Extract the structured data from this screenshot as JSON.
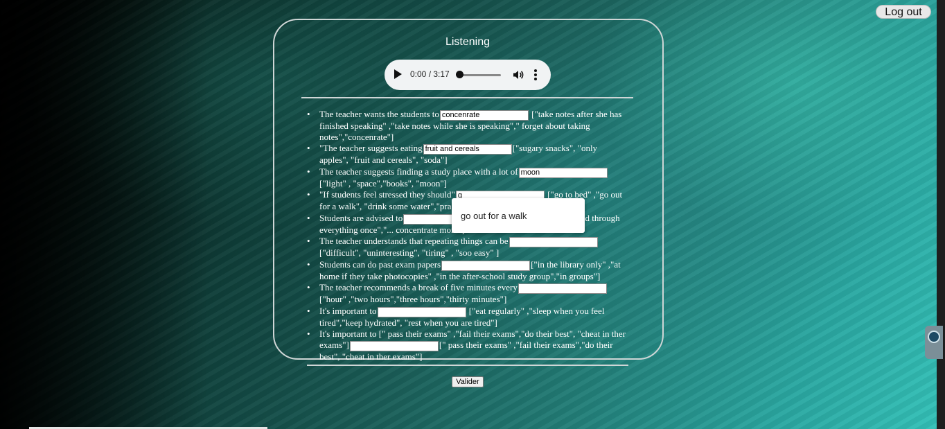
{
  "header": {
    "logout_label": "Log out"
  },
  "section": {
    "title": "Listening"
  },
  "audio": {
    "time": "0:00 / 3:17",
    "progress": 0.0
  },
  "questions": [
    {
      "before": "The teacher wants the students to",
      "value": "concenrate",
      "after": " [\"take notes after she has finished speaking\" ,\"take notes while she is speaking\",\" forget about taking notes\",\"concenrate\"]"
    },
    {
      "before": "\"The teacher suggests eating",
      "value": "fruit and cereals",
      "after": "[\"sugary snacks\", \"only apples\", \"fruit and cereals\", \"soda\"]"
    },
    {
      "before": "The teacher suggests finding a study place with a lot of",
      "value": "moon",
      "after": "[\"light\" , \"space\",\"books\", \"moon\"]"
    },
    {
      "before": "\"If students feel stressed they should\"",
      "value": "g",
      "after": " [\"go to bed\" ,\"go out for a walk\", \"drink some water\",\"practice ..."
    },
    {
      "before": "Students are advised to",
      "value": "",
      "after": " [\"... things to learn\", \"read through everything once\",\"... concentrate more\"]"
    },
    {
      "before": "The teacher understands that repeating things can be",
      "value": "",
      "after": " [\"difficult\", \"uninteresting\", \"tiring\" , \"soo easy\" ]"
    },
    {
      "before": "Students can do past exam papers",
      "value": "",
      "after": "[\"in the library only\" ,\"at home if they take photocopies\" ,\"in the after-school study group\",\"in groups\"]"
    },
    {
      "before": "The teacher recommends a break of five minutes every",
      "value": "",
      "after": " [\"hour\" ,\"two hours\",\"three hours\",\"thirty minutes\"]"
    },
    {
      "before": "It's important to",
      "value": "",
      "after": " [\"eat regularly\" ,\"sleep when you feel tired\",\"keep hydrated\", \"rest when you are tired\"]"
    },
    {
      "before": "It's important to [\" pass their exams\" ,\"fail their exams\",\"do their best\", \"cheat in ther exams\"]",
      "value": "",
      "after": "[\" pass their exams\" ,\"fail their exams\",\"do their best\", \"cheat in ther exams\"]"
    }
  ],
  "autocomplete": {
    "suggestion": "go out for a walk"
  },
  "footer": {
    "submit_label": "Valider"
  }
}
